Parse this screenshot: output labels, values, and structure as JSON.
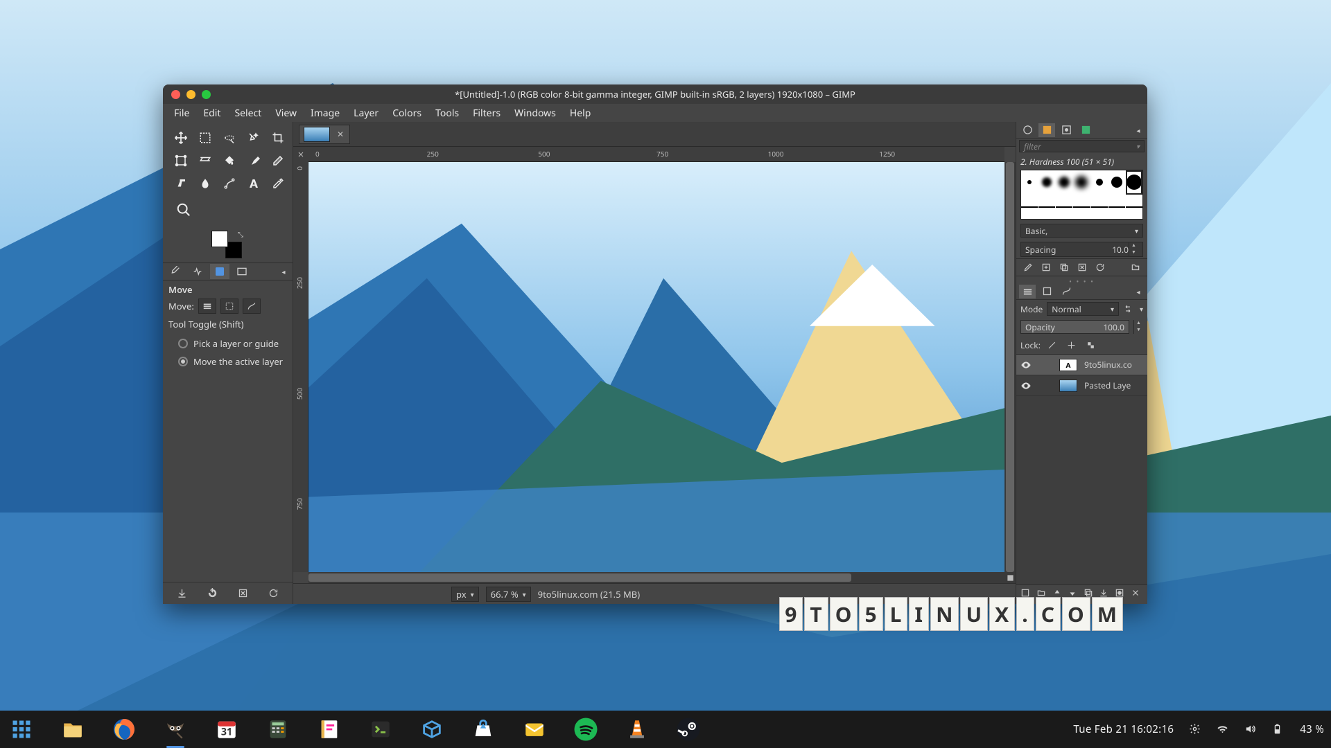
{
  "desktop": {
    "clock": "Tue Feb 21  16:02:16",
    "battery": "43 %"
  },
  "taskbar": {
    "apps": [
      "app-launcher",
      "files",
      "firefox",
      "gimp",
      "calendar",
      "calculator",
      "notes",
      "terminal",
      "virtualbox",
      "software-center",
      "mail",
      "spotify",
      "vlc",
      "steam"
    ]
  },
  "watermark": "9TO5LINUX.COM",
  "gimp": {
    "title": "*[Untitled]-1.0 (RGB color 8-bit gamma integer, GIMP built-in sRGB, 2 layers) 1920x1080 – GIMP",
    "menu": [
      "File",
      "Edit",
      "Select",
      "View",
      "Image",
      "Layer",
      "Colors",
      "Tools",
      "Filters",
      "Windows",
      "Help"
    ],
    "tool_options": {
      "title": "Move",
      "move_label": "Move:",
      "toggle_label": "Tool Toggle  (Shift)",
      "radio_pick": "Pick a layer or guide",
      "radio_move": "Move the active layer"
    },
    "ruler_marks": [
      "0",
      "250",
      "500",
      "750",
      "1000",
      "1250"
    ],
    "status": {
      "unit": "px",
      "zoom": "66.7 %",
      "info": "9to5linux.com (21.5 MB)"
    },
    "brushes": {
      "filter_ph": "filter",
      "label": "2. Hardness 100 (51 × 51)",
      "tag": "Basic,",
      "spacing_label": "Spacing",
      "spacing_value": "10.0"
    },
    "layers": {
      "mode_label": "Mode",
      "mode_value": "Normal",
      "opacity_label": "Opacity",
      "opacity_value": "100.0",
      "lock_label": "Lock:",
      "items": [
        {
          "name": "9to5linux.co",
          "visible": true,
          "type": "text"
        },
        {
          "name": "Pasted Laye",
          "visible": true,
          "type": "image"
        }
      ]
    }
  }
}
